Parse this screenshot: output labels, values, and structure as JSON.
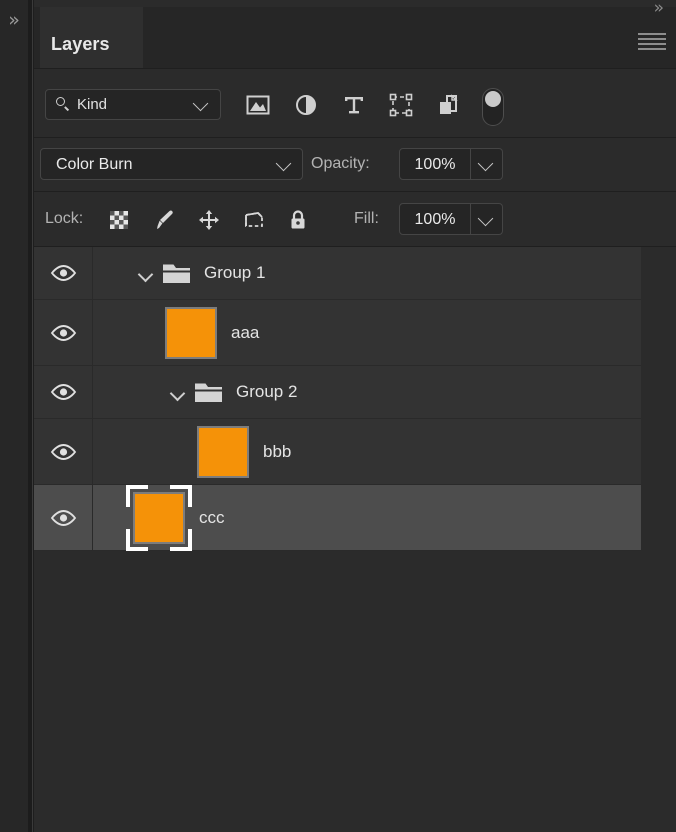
{
  "dock": {
    "expand_icon": "double-chevron-right",
    "expand_glyph": "»"
  },
  "panel": {
    "tab_label": "Layers",
    "menu_icon": "hamburger-menu-icon",
    "top_right_glyph": "»"
  },
  "filter": {
    "kind_label": "Kind",
    "search_icon": "search-icon",
    "chevron_icon": "chevron-down-icon",
    "icons": [
      {
        "name": "filter-image-icon",
        "title": "Pixel layers"
      },
      {
        "name": "filter-adjustment-icon",
        "title": "Adjustment layers"
      },
      {
        "name": "filter-text-icon",
        "title": "Type layers"
      },
      {
        "name": "filter-shape-icon",
        "title": "Shape layers"
      },
      {
        "name": "filter-smart-object-icon",
        "title": "Smart objects"
      }
    ],
    "toggle": {
      "name": "filter-enable-toggle",
      "state": "off"
    }
  },
  "blend": {
    "mode": "Color Burn",
    "opacity_label": "Opacity:",
    "opacity_value": "100%"
  },
  "lock": {
    "label": "Lock:",
    "icons": [
      {
        "name": "lock-transparency-icon"
      },
      {
        "name": "lock-image-pixels-icon"
      },
      {
        "name": "lock-position-icon"
      },
      {
        "name": "lock-artboard-nesting-icon"
      },
      {
        "name": "lock-all-icon"
      }
    ],
    "fill_label": "Fill:",
    "fill_value": "100%"
  },
  "layers": [
    {
      "name": "Group 1",
      "type": "group",
      "indent": 0,
      "visible": true,
      "expanded": true,
      "selected": false,
      "thumb_color": null
    },
    {
      "name": "aaa",
      "type": "layer",
      "indent": 1,
      "visible": true,
      "expanded": false,
      "selected": false,
      "thumb_color": "#F59208"
    },
    {
      "name": "Group 2",
      "type": "group",
      "indent": 1,
      "visible": true,
      "expanded": true,
      "selected": false,
      "thumb_color": null
    },
    {
      "name": "bbb",
      "type": "layer",
      "indent": 2,
      "visible": true,
      "expanded": false,
      "selected": false,
      "thumb_color": "#F59208"
    },
    {
      "name": "ccc",
      "type": "layer",
      "indent": 0,
      "visible": true,
      "expanded": false,
      "selected": true,
      "thumb_color": "#F59208"
    }
  ],
  "colors": {
    "panel_background": "#2b2b2b",
    "row_background": "#333333",
    "row_selected": "#4d4d4d",
    "thumbnail_orange": "#F59208",
    "text": "#e4e4e4"
  }
}
